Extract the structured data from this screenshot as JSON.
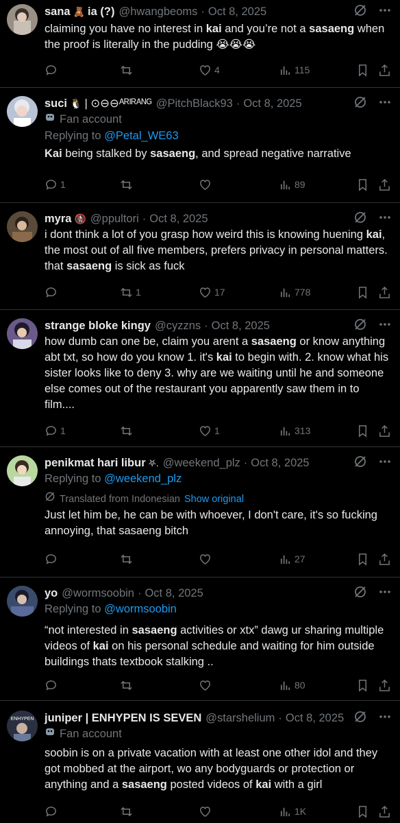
{
  "tweets": [
    {
      "name": "sana",
      "name_emoji": "🧸",
      "name_suffix": "ia (?)",
      "handle": "@hwangbeoms",
      "date": "Oct 8, 2025",
      "text_parts": [
        "claiming you have no interest in ",
        "kai",
        " and you’re not a ",
        "sasaeng",
        " when the proof is literally in the pudding 😭😭😭"
      ],
      "reply_count": "",
      "retweet_count": "",
      "like_count": "4",
      "view_count": "115"
    },
    {
      "name": "suci",
      "name_emoji": "🐧",
      "name_suffix": "| ⊙⊖⊖ᴬᴿᴵᴿᴬᴺᴳ",
      "handle": "@PitchBlack93",
      "date": "Oct 8, 2025",
      "fan_label": "Fan account",
      "replying_label": "Replying to",
      "replying_to": "@Petal_WE63",
      "text_parts": [
        "Kai",
        " being stalked by ",
        "sasaeng",
        ", and spread negative narrative"
      ],
      "reply_count": "1",
      "retweet_count": "",
      "like_count": "",
      "view_count": "89"
    },
    {
      "name": "myra",
      "name_emoji": "🚷",
      "handle": "@ppultori",
      "date": "Oct 8, 2025",
      "text_parts": [
        "i dont think a lot of you grasp how weird this is knowing huening ",
        "kai",
        ", the most out of all five members, prefers privacy in personal matters. that ",
        "sasaeng",
        " is sick as fuck"
      ],
      "reply_count": "",
      "retweet_count": "1",
      "like_count": "17",
      "view_count": "778"
    },
    {
      "name": "strange bloke kingy",
      "handle": "@cyzzns",
      "date": "Oct 8, 2025",
      "text_parts": [
        "how dumb can one be, claim you arent a ",
        "sasaeng",
        " or know anything abt txt, so how do you know 1. it's ",
        "kai",
        " to begin with. 2. know what his sister looks like to deny 3. why are we waiting until he and someone else comes out of the restaurant you apparently saw them in to film...."
      ],
      "reply_count": "1",
      "retweet_count": "",
      "like_count": "1",
      "view_count": "313"
    },
    {
      "name": "penikmat hari libur",
      "name_emoji": "⛧.",
      "handle": "@weekend_plz",
      "date": "Oct 8, 2025",
      "replying_label": "Replying to",
      "replying_to": "@weekend_plz",
      "translated_label": "Translated from Indonesian",
      "show_original": "Show original",
      "text_parts": [
        "Just let him be, he can be with whoever, I don't care, it's so fucking annoying, that sasaeng bitch"
      ],
      "reply_count": "",
      "retweet_count": "",
      "like_count": "",
      "view_count": "27"
    },
    {
      "name": "yo",
      "handle": "@wormsoobin",
      "date": "Oct 8, 2025",
      "replying_label": "Replying to",
      "replying_to": "@wormsoobin",
      "text_parts": [
        "“not interested in ",
        "sasaeng",
        " activities or xtx” dawg ur sharing multiple videos of ",
        "kai",
        " on his personal schedule and waiting for him outside buildings thats textbook stalking .."
      ],
      "reply_count": "",
      "retweet_count": "",
      "like_count": "",
      "view_count": "80"
    },
    {
      "name": "juniper | ENHYPEN IS SEVEN",
      "handle": "@starshelium",
      "date": "Oct 8, 2025",
      "fan_label": "Fan account",
      "text_parts": [
        "soobin is on a private vacation with at least one other idol and they got mobbed at the airport, wo any bodyguards or protection or anything and a ",
        "sasaeng",
        " posted videos of ",
        "kai",
        " with a girl"
      ],
      "reply_count": "",
      "retweet_count": "",
      "like_count": "",
      "view_count": "1K"
    }
  ],
  "avatar_text": "ENHYPEN"
}
